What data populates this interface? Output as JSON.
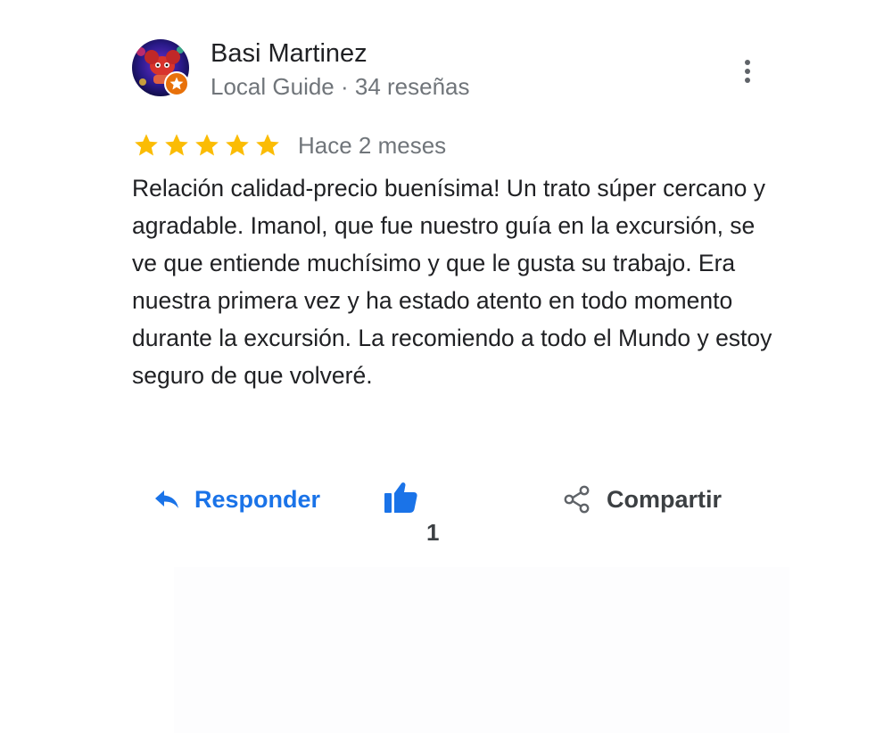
{
  "review": {
    "author_name": "Basi Martinez",
    "author_meta": "Local Guide · 34 reseñas",
    "rating": 5,
    "max_rating": 5,
    "time_ago": "Hace 2 meses",
    "text": "Relación calidad-precio buenísima! Un trato súper cercano y agradable. Imanol, que fue nuestro guía en la excursión, se ve que entiende muchísimo y que le gusta su trabajo. Era nuestra primera vez y ha estado atento en todo momento durante la excursión. La recomiendo a todo el Mundo y estoy seguro de que volveré."
  },
  "actions": {
    "reply_label": "Responder",
    "like_count": "1",
    "share_label": "Compartir"
  },
  "icons": {
    "more": "more-vert-icon",
    "reply": "reply-arrow-icon",
    "like": "thumbs-up-icon",
    "share": "share-icon",
    "star": "star-icon",
    "badge": "local-guide-badge-icon"
  },
  "colors": {
    "star": "#fbbc04",
    "link_blue": "#1a73e8",
    "text_primary": "#202124",
    "text_secondary": "#70757a",
    "badge_orange": "#e8710a"
  }
}
